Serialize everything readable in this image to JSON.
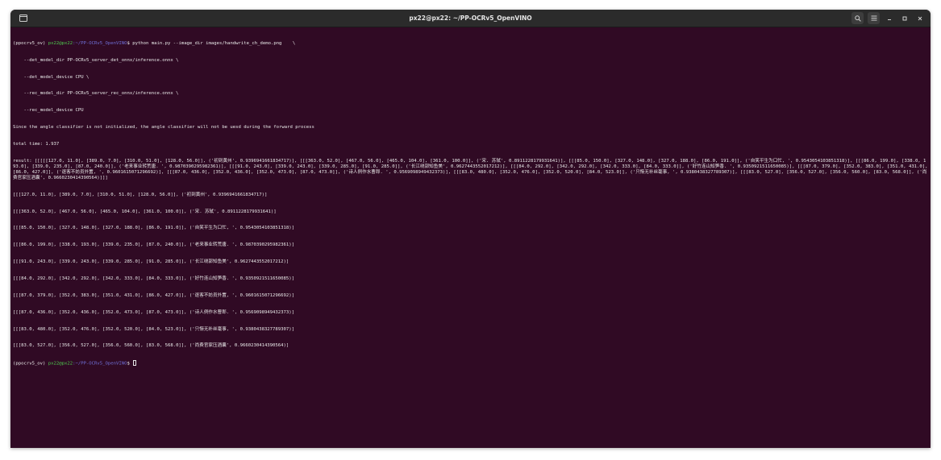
{
  "window": {
    "title": "px22@px22: ~/PP-OCRv5_OpenVINO",
    "colors": {
      "terminal_bg": "#300a24",
      "titlebar_bg": "#2b2b2b",
      "prompt_user": "#4ec94e",
      "prompt_path": "#6f6fd6",
      "text": "#e8e8e8"
    },
    "icons": {
      "new_tab": "terminal-tab-icon",
      "search": "search-icon",
      "menu": "hamburger-menu-icon",
      "minimize": "minimize-icon",
      "maximize": "maximize-icon",
      "close": "close-icon"
    }
  },
  "terminal": {
    "prompt1": {
      "env": "(ppocrv5_ov) ",
      "user": "px22@px22",
      "path": ":~/PP-OCRv5_OpenVINO",
      "symbol": "$ ",
      "command": "python main.py --image_dir images/handwrite_ch_demo.png    \\"
    },
    "cmd_lines": [
      "    --det_model_dir PP-OCRv5_server_det_onnx/inference.onnx \\",
      "    --det_model_device CPU \\",
      "    --rec_model_dir PP-OCRv5_server_rec_onnx/inference.onnx \\",
      "    --rec_model_device CPU"
    ],
    "info_lines": [
      "Since the angle classifier is not initialized, the angle classifier will not be uesd during the forward process",
      "total time: 1.937"
    ],
    "result_text": "result: [[[[[127.0, 11.0], [389.0, 7.0], [310.0, 51.0], [128.0, 56.0]], ('初到黄州', 0.9396941661834717)], [[[363.0, 52.0], [467.0, 56.0], [465.0, 104.0], [361.0, 100.0]], ('宋. 苏轼', 0.8911228179931641)], [[[85.0, 150.0], [327.0, 148.0], [327.0, 188.0], [86.0, 191.0]], ('自笑平生为口忙, ', 0.9543054103851318)], [[[86.0, 199.0], [338.0, 193.0], [339.0, 235.0], [87.0, 240.0]], ('老来事业转荒唐. ', 0.9870390295982361)], [[[91.0, 243.0], [339.0, 243.0], [339.0, 285.0], [91.0, 285.0]], ('长江绕郭知鱼美', 0.9627443552017212)], [[[84.0, 292.0], [342.0, 292.0], [342.0, 333.0], [84.0, 333.0]], ('好竹连山知笋香. ', 0.9350921511650085)], [[[87.0, 379.0], [352.0, 383.0], [351.0, 431.0], [86.0, 427.0]], ('逐客不妨员外置, ', 0.9601615071296692)], [[[87.0, 436.0], [352.0, 436.0], [352.0, 473.0], [87.0, 473.0]], ('诗人例作水曹郎. ', 0.9569098949432373)], [[[83.0, 480.0], [352.0, 476.0], [352.0, 520.0], [84.0, 523.0]], ('只惭无补丝毫事, ', 0.9380438327789307)], [[[83.0, 527.0], [356.0, 527.0], [356.0, 560.0], [83.0, 568.0]], ('尚费官家压酒囊', 0.9660230414390564)]]]",
    "box_lines": [
      "[[[127.0, 11.0], [389.0, 7.0], [310.0, 51.0], [128.0, 56.0]], ('初到黄州', 0.9396941661834717)]",
      "[[[363.0, 52.0], [467.0, 56.0], [465.0, 104.0], [361.0, 100.0]], ('宋. 苏轼', 0.8911228179931641)]",
      "[[[85.0, 150.0], [327.0, 148.0], [327.0, 188.0], [86.0, 191.0]], ('自笑平生为口忙, ', 0.9543054103851318)]",
      "[[[86.0, 199.0], [338.0, 193.0], [339.0, 235.0], [87.0, 240.0]], ('老来事业转荒唐. ', 0.9870390295982361)]",
      "[[[91.0, 243.0], [339.0, 243.0], [339.0, 285.0], [91.0, 285.0]], ('长江绕郭知鱼美', 0.9627443552017212)]",
      "[[[84.0, 292.0], [342.0, 292.0], [342.0, 333.0], [84.0, 333.0]], ('好竹连山知笋香. ', 0.9350921511650085)]",
      "[[[87.0, 379.0], [352.0, 383.0], [351.0, 431.0], [86.0, 427.0]], ('逐客不妨员外置, ', 0.9601615071296692)]",
      "[[[87.0, 436.0], [352.0, 436.0], [352.0, 473.0], [87.0, 473.0]], ('诗人例作水曹郎. ', 0.9569098949432373)]",
      "[[[83.0, 480.0], [352.0, 476.0], [352.0, 520.0], [84.0, 523.0]], ('只惭无补丝毫事, ', 0.9380438327789307)]",
      "[[[83.0, 527.0], [356.0, 527.0], [356.0, 560.0], [83.0, 568.0]], ('尚费官家压酒囊', 0.9660230414390564)]"
    ],
    "prompt2": {
      "env": "(ppocrv5_ov) ",
      "user": "px22@px22",
      "path": ":~/PP-OCRv5_OpenVINO",
      "symbol": "$ "
    }
  }
}
